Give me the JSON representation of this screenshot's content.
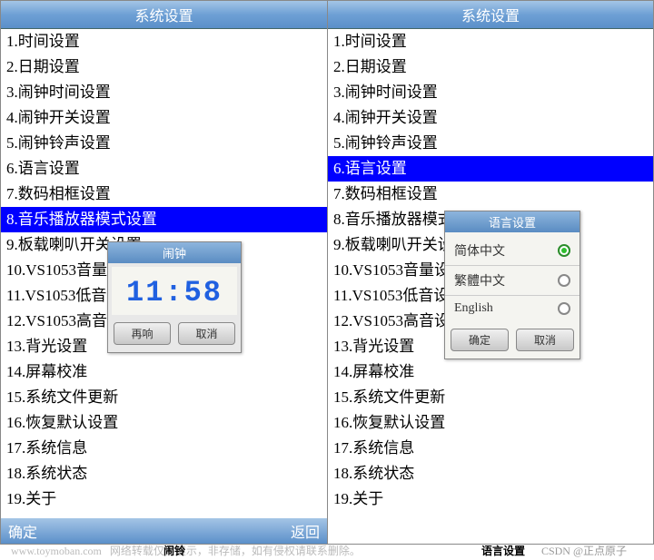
{
  "title": "系统设置",
  "menu_items": [
    "1.时间设置",
    "2.日期设置",
    "3.闹钟时间设置",
    "4.闹钟开关设置",
    "5.闹钟铃声设置",
    "6.语言设置",
    "7.数码相框设置",
    "8.音乐播放器模式设置",
    "9.板载喇叭开关设置",
    "10.VS1053音量设置",
    "11.VS1053低音设置",
    "12.VS1053高音设置",
    "13.背光设置",
    "14.屏幕校准",
    "15.系统文件更新",
    "16.恢复默认设置",
    "17.系统信息",
    "18.系统状态",
    "19.关于"
  ],
  "left": {
    "selected_index": 7,
    "bottom_left": "确定",
    "bottom_right": "返回",
    "caption": "闹铃"
  },
  "right": {
    "selected_index": 5,
    "caption": "语言设置"
  },
  "alarm_popup": {
    "title": "闹钟",
    "time": "11:58",
    "snooze": "再响",
    "cancel": "取消"
  },
  "lang_popup": {
    "title": "语言设置",
    "options": [
      {
        "label": "简体中文",
        "checked": true
      },
      {
        "label": "繁體中文",
        "checked": false
      },
      {
        "label": "English",
        "checked": false
      }
    ],
    "ok": "确定",
    "cancel": "取消"
  },
  "watermark": {
    "site": "www.toymoban.com",
    "note": "网络转载仅供展示，非存储，如有侵权请联系删除。",
    "attribution": "CSDN @正点原子"
  }
}
